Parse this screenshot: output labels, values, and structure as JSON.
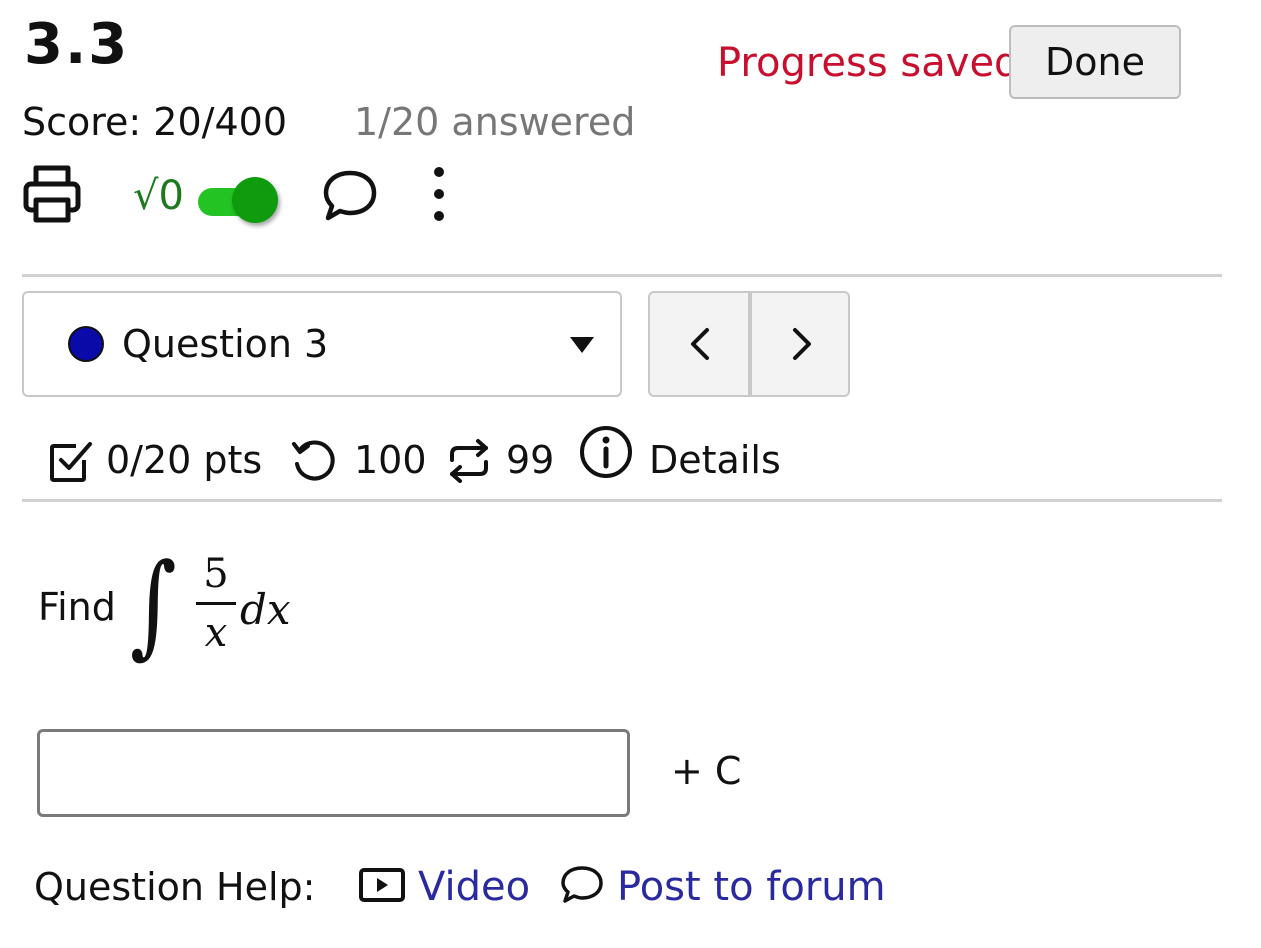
{
  "header": {
    "title": "3.3",
    "status": "Progress saved",
    "done_label": "Done",
    "score": "Score: 20/400",
    "answered": "1/20 answered"
  },
  "toolbar": {
    "print_icon": "printer-icon",
    "math_toggle_label": "√0",
    "math_toggle_on": true,
    "comment_icon": "speech-bubble-icon",
    "more_icon": "vertical-ellipsis-icon"
  },
  "question_select": {
    "label": "Question 3",
    "dot_color": "#0a0aa8"
  },
  "meta": {
    "points": "0/20 pts",
    "attempts": "100",
    "versions": "99",
    "details_label": "Details"
  },
  "question": {
    "prompt": "Find",
    "numerator": "5",
    "denominator": "x",
    "differential": "dx",
    "answer_value": "",
    "suffix": "+ C"
  },
  "help": {
    "label": "Question Help:",
    "video_label": "Video",
    "forum_label": "Post to forum"
  },
  "colors": {
    "status_red": "#c8102e",
    "toggle_green": "#22c322",
    "link_blue": "#2a2aa0"
  }
}
